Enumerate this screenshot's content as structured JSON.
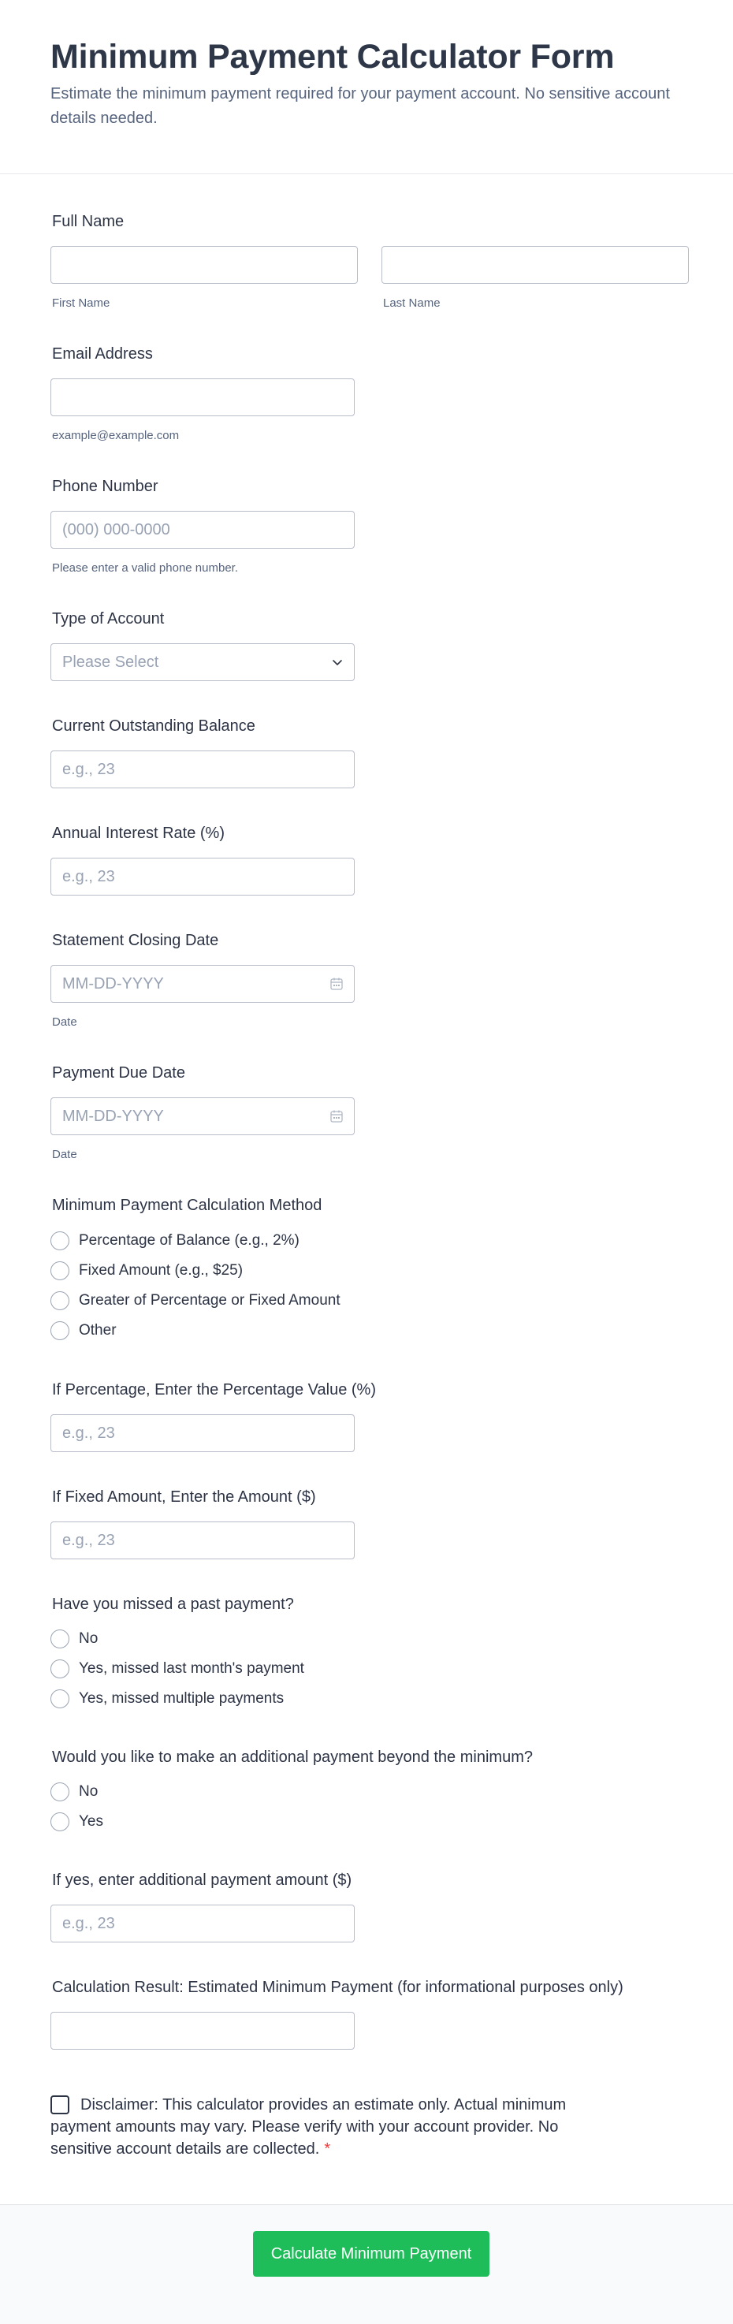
{
  "form": {
    "title": "Minimum Payment Calculator Form",
    "subtitle": "Estimate the minimum payment required for your payment account. No sensitive account details needed."
  },
  "full_name": {
    "label": "Full Name",
    "first_sublabel": "First Name",
    "last_sublabel": "Last Name"
  },
  "email": {
    "label": "Email Address",
    "sublabel": "example@example.com"
  },
  "phone": {
    "label": "Phone Number",
    "placeholder": "(000) 000-0000",
    "sublabel": "Please enter a valid phone number."
  },
  "account_type": {
    "label": "Type of Account",
    "placeholder": "Please Select"
  },
  "balance": {
    "label": "Current Outstanding Balance",
    "placeholder": "e.g., 23"
  },
  "interest": {
    "label": "Annual Interest Rate (%)",
    "placeholder": "e.g., 23"
  },
  "statement_date": {
    "label": "Statement Closing Date",
    "placeholder": "MM-DD-YYYY",
    "sublabel": "Date"
  },
  "due_date": {
    "label": "Payment Due Date",
    "placeholder": "MM-DD-YYYY",
    "sublabel": "Date"
  },
  "method": {
    "label": "Minimum Payment Calculation Method",
    "options": [
      "Percentage of Balance (e.g., 2%)",
      "Fixed Amount (e.g., $25)",
      "Greater of Percentage or Fixed Amount",
      "Other"
    ]
  },
  "percentage": {
    "label": "If Percentage, Enter the Percentage Value (%)",
    "placeholder": "e.g., 23"
  },
  "fixed_amount": {
    "label": "If Fixed Amount, Enter the Amount ($)",
    "placeholder": "e.g., 23"
  },
  "missed": {
    "label": "Have you missed a past payment?",
    "options": [
      "No",
      "Yes, missed last month's payment",
      "Yes, missed multiple payments"
    ]
  },
  "additional": {
    "label": "Would you like to make an additional payment beyond the minimum?",
    "options": [
      "No",
      "Yes"
    ]
  },
  "additional_amount": {
    "label": "If yes, enter additional payment amount ($)",
    "placeholder": "e.g., 23"
  },
  "result": {
    "label": "Calculation Result: Estimated Minimum Payment (for informational purposes only)"
  },
  "disclaimer": {
    "text": "Disclaimer: This calculator provides an estimate only. Actual minimum payment amounts may vary. Please verify with your account provider. No sensitive account details are collected.",
    "required_mark": "*"
  },
  "submit": {
    "label": "Calculate Minimum Payment"
  },
  "colors": {
    "primary_button": "#1fbd5a",
    "required": "#f23a3c"
  }
}
